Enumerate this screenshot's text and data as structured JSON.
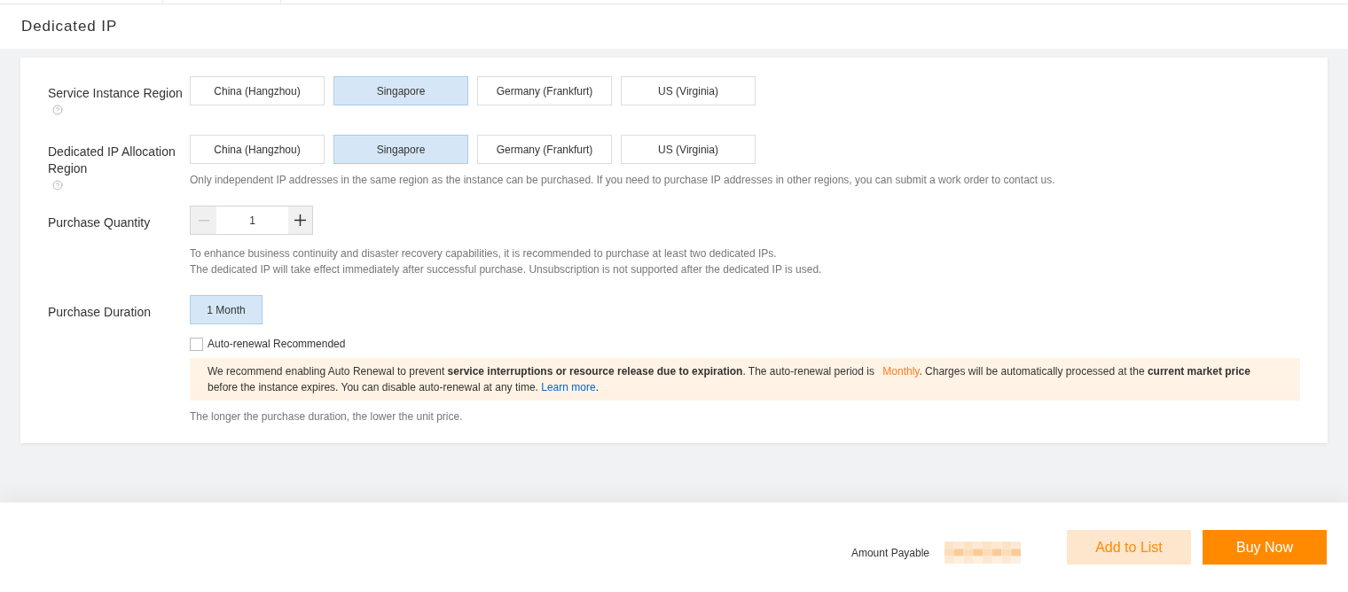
{
  "page": {
    "title": "Dedicated IP"
  },
  "form": {
    "fields": [
      {
        "label": "Service Instance Region",
        "help": true,
        "controls": [
          {
            "kind": "options",
            "options": [
              {
                "label": "China (Hangzhou)",
                "selected": false
              },
              {
                "label": "Singapore",
                "selected": true
              },
              {
                "label": "Germany (Frankfurt)",
                "selected": false
              },
              {
                "label": "US (Virginia)",
                "selected": false
              }
            ]
          }
        ]
      },
      {
        "label": "Dedicated IP Allocation Region",
        "help": true,
        "controls": [
          {
            "kind": "options",
            "options": [
              {
                "label": "China (Hangzhou)",
                "selected": false
              },
              {
                "label": "Singapore",
                "selected": true
              },
              {
                "label": "Germany (Frankfurt)",
                "selected": false
              },
              {
                "label": "US (Virginia)",
                "selected": false
              }
            ]
          },
          {
            "kind": "hint",
            "lines": [
              "Only independent IP addresses in the same region as the instance can be purchased. If you need to purchase IP addresses in other regions, you can submit a work order to contact us."
            ]
          }
        ]
      },
      {
        "label": "Purchase Quantity",
        "help": false,
        "controls": [
          {
            "kind": "stepper",
            "value": "1",
            "decrement_disabled": true
          },
          {
            "kind": "hint",
            "lines": [
              "To enhance business continuity and disaster recovery capabilities, it is recommended to purchase at least two dedicated IPs.",
              "The dedicated IP will take effect immediately after successful purchase. Unsubscription is not supported after the dedicated IP is used."
            ]
          }
        ]
      },
      {
        "label": "Purchase Duration",
        "help": false,
        "controls": [
          {
            "kind": "duration",
            "options": [
              {
                "label": "1 Month",
                "selected": true
              }
            ]
          },
          {
            "kind": "checkbox",
            "label": "Auto-renewal Recommended",
            "checked": false
          },
          {
            "kind": "notice",
            "segments": [
              {
                "kind": "text",
                "text": "We recommend enabling Auto Renewal to prevent **service interruptions or resource release due to expiration**. The auto-renewal period is "
              },
              {
                "kind": "highlight",
                "text": "Monthly"
              },
              {
                "kind": "text",
                "text": ". Charges will be automatically processed at the **current market price** before the instance expires. You can disable auto-renewal at any time. "
              },
              {
                "kind": "link",
                "text": "Learn more"
              },
              {
                "kind": "text",
                "text": "."
              }
            ]
          },
          {
            "kind": "hint",
            "lines": [
              "The longer the purchase duration, the lower the unit price."
            ]
          }
        ]
      }
    ]
  },
  "footer": {
    "amount_label": "Amount Payable",
    "buttons": [
      {
        "label": "Add to List",
        "kind": "secondary"
      },
      {
        "label": "Buy Now",
        "kind": "primary"
      }
    ]
  }
}
